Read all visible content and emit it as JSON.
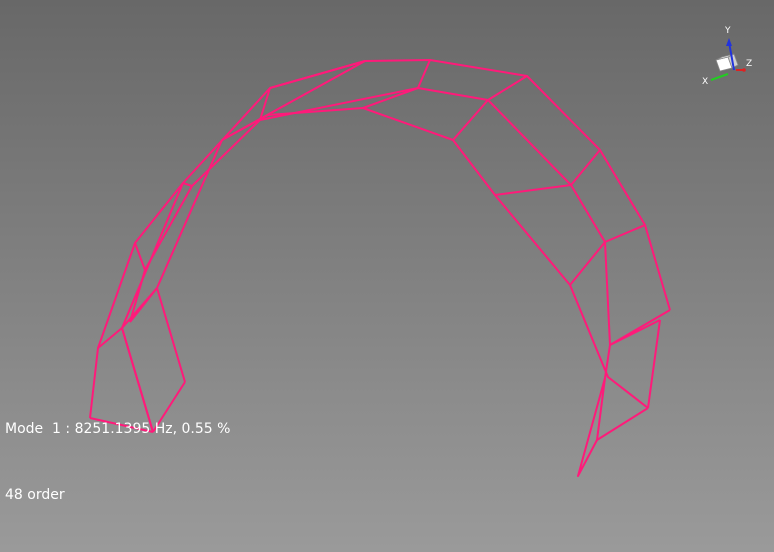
{
  "viewport": {
    "mesh_color": "#ff1a7a",
    "background_top": "#686868",
    "background_bottom": "#9a9a9a"
  },
  "triad": {
    "x_label": "X",
    "y_label": "Y",
    "z_label": "Z",
    "x_color": "#22cc22",
    "y_color": "#2233dd",
    "z_color": "#dd2222"
  },
  "status": {
    "mode_line": "Mode  1 : 8251.1395 Hz, 0.55 %",
    "order_line": "48 order"
  }
}
